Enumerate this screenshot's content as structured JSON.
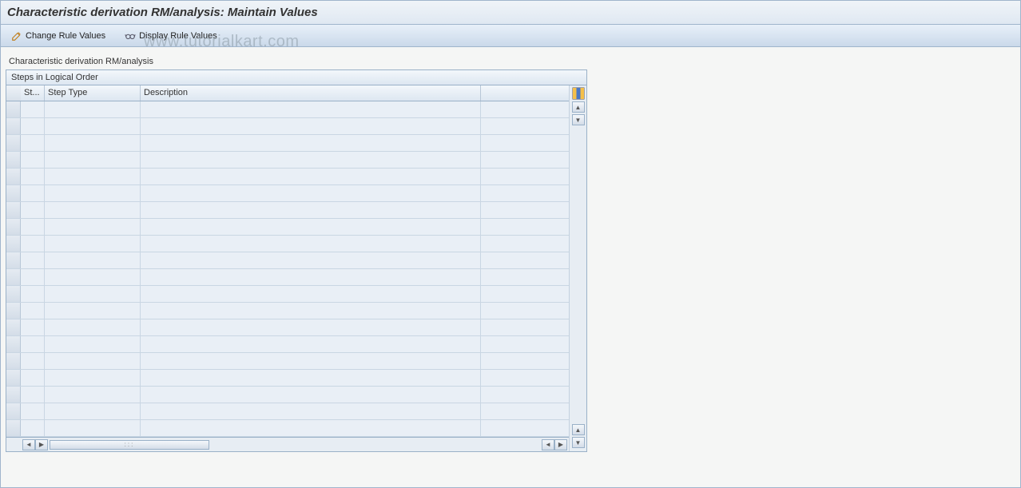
{
  "header": {
    "title": "Characteristic derivation RM/analysis: Maintain Values"
  },
  "toolbar": {
    "change_rule_values": "Change Rule Values",
    "display_rule_values": "Display Rule Values"
  },
  "main": {
    "section_label": "Characteristic derivation RM/analysis",
    "grid_title": "Steps in Logical Order",
    "columns": {
      "st": "St...",
      "step_type": "Step Type",
      "description": "Description"
    },
    "rows": [
      {
        "st": "",
        "step_type": "",
        "description": ""
      },
      {
        "st": "",
        "step_type": "",
        "description": ""
      },
      {
        "st": "",
        "step_type": "",
        "description": ""
      },
      {
        "st": "",
        "step_type": "",
        "description": ""
      },
      {
        "st": "",
        "step_type": "",
        "description": ""
      },
      {
        "st": "",
        "step_type": "",
        "description": ""
      },
      {
        "st": "",
        "step_type": "",
        "description": ""
      },
      {
        "st": "",
        "step_type": "",
        "description": ""
      },
      {
        "st": "",
        "step_type": "",
        "description": ""
      },
      {
        "st": "",
        "step_type": "",
        "description": ""
      },
      {
        "st": "",
        "step_type": "",
        "description": ""
      },
      {
        "st": "",
        "step_type": "",
        "description": ""
      },
      {
        "st": "",
        "step_type": "",
        "description": ""
      },
      {
        "st": "",
        "step_type": "",
        "description": ""
      },
      {
        "st": "",
        "step_type": "",
        "description": ""
      },
      {
        "st": "",
        "step_type": "",
        "description": ""
      },
      {
        "st": "",
        "step_type": "",
        "description": ""
      },
      {
        "st": "",
        "step_type": "",
        "description": ""
      },
      {
        "st": "",
        "step_type": "",
        "description": ""
      },
      {
        "st": "",
        "step_type": "",
        "description": ""
      }
    ]
  },
  "watermark": "www.tutorialkart.com"
}
